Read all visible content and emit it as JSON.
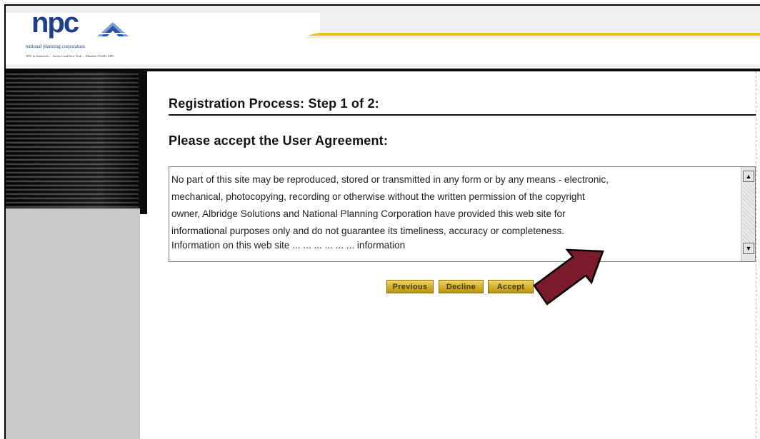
{
  "header": {
    "logo_word": "npc",
    "logo_tagline": "national planning corporation",
    "logo_subline": "NPC in America's ... Service and New York ... Member NASD, SIPC",
    "accent_stripe_color": "#e9c417",
    "brand_color": "#1f3f8c"
  },
  "main": {
    "step_title": "Registration Process: Step 1 of 2:",
    "agreement_heading": "Please accept the User Agreement:",
    "agreement_lines": [
      "No part of this site may be reproduced, stored or transmitted in any form or by any means - electronic,",
      "mechanical, photocopying, recording or otherwise without the written permission of the copyright",
      "owner, Albridge Solutions and National Planning Corporation have provided this web site for",
      "informational purposes only and do not guarantee its timeliness, accuracy or completeness.",
      "Information on this web site ... ... ... ... ... ... information"
    ],
    "scroll_up_icon": "arrow-up-icon",
    "scroll_down_icon": "arrow-down-icon"
  },
  "buttons": {
    "previous": "Previous",
    "decline": "Decline",
    "accept": "Accept",
    "color": "#d2ae2a"
  },
  "annotation": {
    "arrow_icon": "pointer-arrow-icon",
    "arrow_color": "#7a1a2a"
  }
}
